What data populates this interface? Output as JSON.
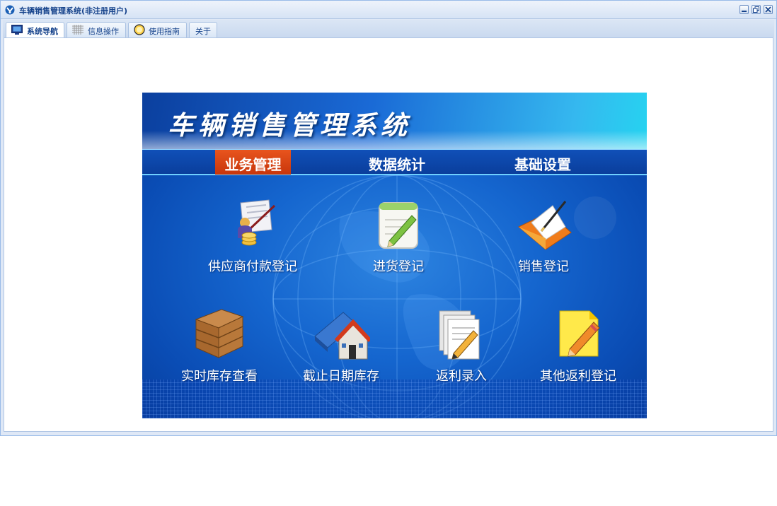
{
  "window": {
    "title": "车辆销售管理系统(非注册用户)"
  },
  "tabs": [
    {
      "label": "系统导航",
      "icon": "monitor-icon",
      "active": true
    },
    {
      "label": "信息操作",
      "icon": "grid-icon",
      "active": false
    },
    {
      "label": "使用指南",
      "icon": "lightbulb-icon",
      "active": false
    },
    {
      "label": "关于",
      "icon": "",
      "active": false
    }
  ],
  "panel": {
    "title": "车辆销售管理系统",
    "nav": [
      {
        "label": "业务管理",
        "active": true
      },
      {
        "label": "数据统计",
        "active": false
      },
      {
        "label": "基础设置",
        "active": false
      }
    ],
    "functions_row1": [
      {
        "label": "供应商付款登记",
        "icon": "supplier-payment-icon"
      },
      {
        "label": "进货登记",
        "icon": "purchase-notepad-icon"
      },
      {
        "label": "销售登记",
        "icon": "sales-folder-icon"
      }
    ],
    "functions_row2": [
      {
        "label": "实时库存查看",
        "icon": "wooden-crate-icon"
      },
      {
        "label": "截止日期库存",
        "icon": "house-book-icon"
      },
      {
        "label": "返利录入",
        "icon": "documents-pencil-icon"
      },
      {
        "label": "其他返利登记",
        "icon": "sticky-note-pencil-icon"
      }
    ]
  },
  "colors": {
    "accent": "#15428b",
    "nav_active": "#d9441a",
    "panel_blue": "#1566cf"
  }
}
